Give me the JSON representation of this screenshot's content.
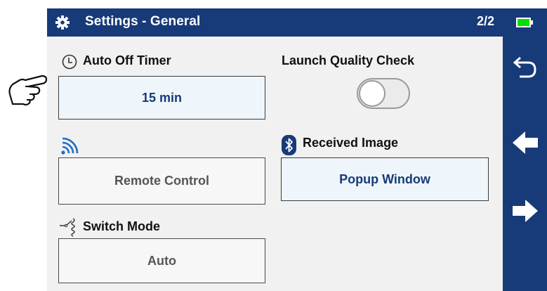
{
  "header": {
    "title": "Settings - General",
    "page_indicator": "2/2",
    "battery_color": "#00e000",
    "icons": [
      "gear-icon",
      "battery-icon"
    ]
  },
  "settings": {
    "auto_off_timer": {
      "label": "Auto Off Timer",
      "value": "15 min",
      "icon": "clock-icon"
    },
    "launch_quality_check": {
      "label": "Launch Quality Check",
      "enabled": false
    },
    "wireless": {
      "icon": "wifi-signal-icon",
      "value": "Remote Control"
    },
    "received_image": {
      "label": "Received Image",
      "icon": "bluetooth-icon",
      "value": "Popup Window"
    },
    "switch_mode": {
      "label": "Switch Mode",
      "icon": "switch-icon",
      "value": "Auto"
    }
  },
  "sidebar": {
    "buttons": [
      "back-icon",
      "arrow-left-icon",
      "arrow-right-icon"
    ]
  },
  "colors": {
    "header_bg": "#173a78",
    "accent": "#1f6fc5"
  }
}
